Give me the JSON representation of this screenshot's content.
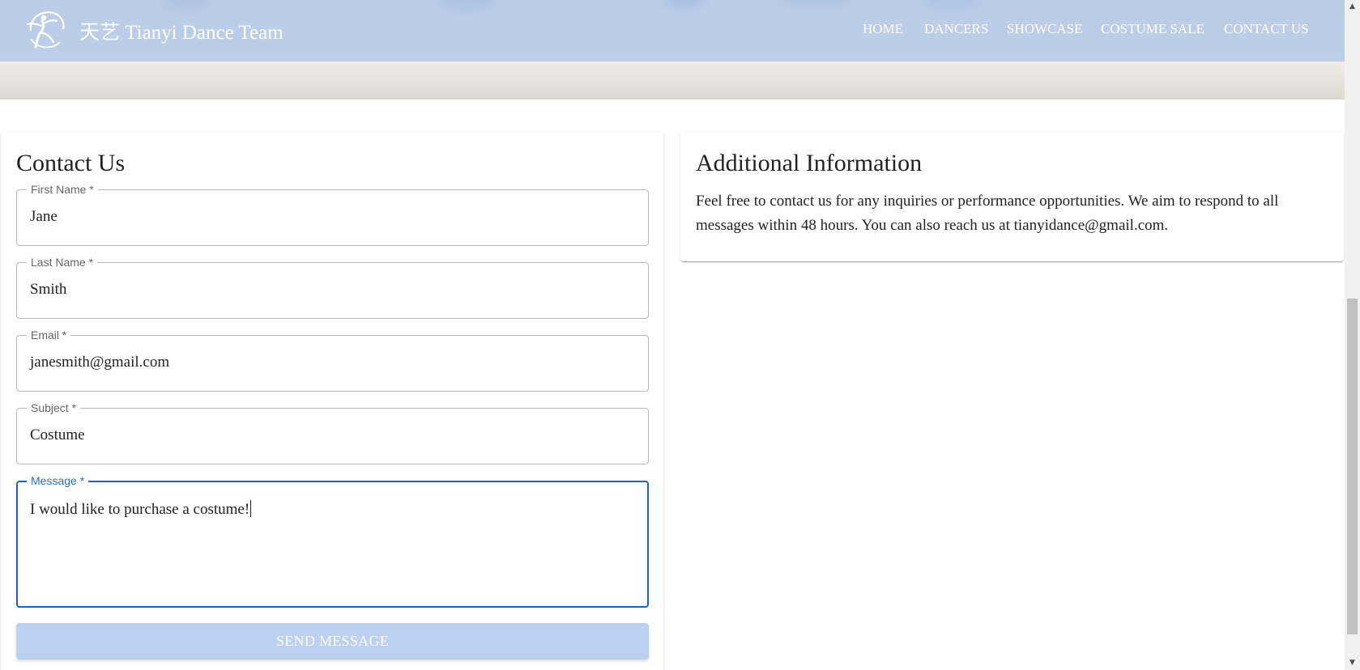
{
  "header": {
    "brand": "天艺 Tianyi Dance Team",
    "logo_icon": "dancer-logo-icon",
    "nav": [
      {
        "label": "HOME"
      },
      {
        "label": "DANCERS"
      },
      {
        "label": "SHOWCASE"
      },
      {
        "label": "COSTUME SALE"
      },
      {
        "label": "CONTACT US"
      }
    ],
    "navbar_color": "#b0c7e8"
  },
  "contact_form": {
    "title": "Contact Us",
    "fields": [
      {
        "label": "First Name *",
        "value": "Jane"
      },
      {
        "label": "Last Name *",
        "value": "Smith"
      },
      {
        "label": "Email *",
        "value": "janesmith@gmail.com"
      },
      {
        "label": "Subject *",
        "value": "Costume"
      },
      {
        "label": "Message *",
        "value": "I would like to purchase a costume!"
      }
    ],
    "submit_label": "SEND MESSAGE",
    "focus_color": "#1e63c4",
    "button_color": "#bcd0ef"
  },
  "additional_info": {
    "title": "Additional Information",
    "text": "Feel free to contact us for any inquiries or performance opportunities. We aim to respond to all messages within 48 hours. You can also reach us at tianyidance@gmail.com."
  }
}
